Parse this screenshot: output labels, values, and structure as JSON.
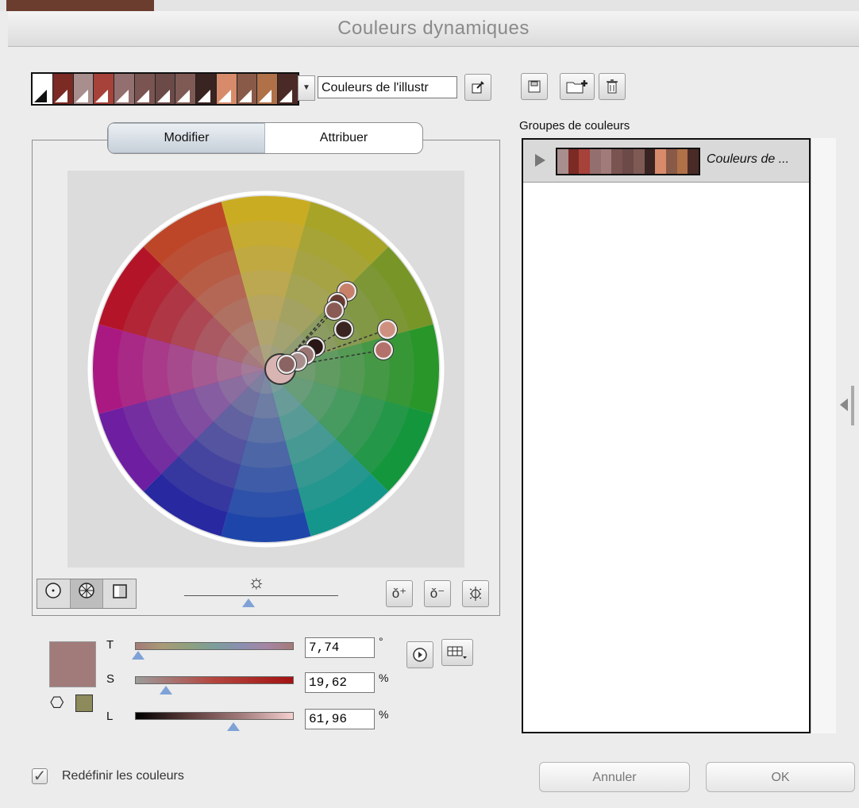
{
  "window": {
    "title": "Couleurs dynamiques"
  },
  "harmony": {
    "swatches": [
      "#ffffff",
      "#7b2a24",
      "#a88f8e",
      "#a6423a",
      "#946f70",
      "#7a5450",
      "#6b4a48",
      "#7f5a55",
      "#3a2422",
      "#d88b6a",
      "#8a5a48",
      "#b07048",
      "#4a2a26"
    ],
    "name_field": "Couleurs de l'illustr",
    "name_field_icon": "eyedropper-icon"
  },
  "toolbar_right": {
    "icons": [
      "save-group-icon",
      "new-group-folder-icon",
      "delete-icon"
    ]
  },
  "tabs": [
    {
      "label": "Modifier",
      "active": true
    },
    {
      "label": "Attribuer",
      "active": false
    }
  ],
  "wheel_modes": {
    "icons": [
      "smooth-wheel-icon",
      "segmented-wheel-icon",
      "color-bars-icon"
    ],
    "active": 1
  },
  "brightness": {
    "icon": "sun-icon",
    "level": 0.42
  },
  "wheel_tools": {
    "icons": [
      "add-color-tool-icon",
      "remove-color-tool-icon",
      "unlink-colors-icon"
    ]
  },
  "sliders": [
    {
      "label": "T",
      "value": "7,74",
      "unit": "°",
      "level": 0.02
    },
    {
      "label": "S",
      "value": "19,62",
      "unit": "%",
      "level": 0.196
    },
    {
      "label": "L",
      "value": "61,96",
      "unit": "%",
      "level": 0.62
    }
  ],
  "preview": {
    "color": "#a17b7a",
    "gamut_color": "#8d8a5b"
  },
  "slider_buttons": {
    "icons": [
      "play-options-icon",
      "color-mode-menu-icon"
    ]
  },
  "groups": {
    "label": "Groupes de couleurs",
    "items": [
      {
        "name": "Couleurs de ...",
        "colors": [
          "#a88f8e",
          "#7b2a24",
          "#a6423a",
          "#946f70",
          "#a17b7a",
          "#7a5450",
          "#6b4a48",
          "#7f5a55",
          "#3a2422",
          "#d88b6a",
          "#8a5a48",
          "#b07048",
          "#4a2a26"
        ]
      }
    ]
  },
  "footer": {
    "recolor_label": "Redéfinir les couleurs",
    "recolor_checked": true,
    "cancel_label": "Annuler",
    "ok_label": "OK"
  },
  "colors": {
    "accent_thumb": "#7fa2d6",
    "panel_bg": "#ececec"
  }
}
